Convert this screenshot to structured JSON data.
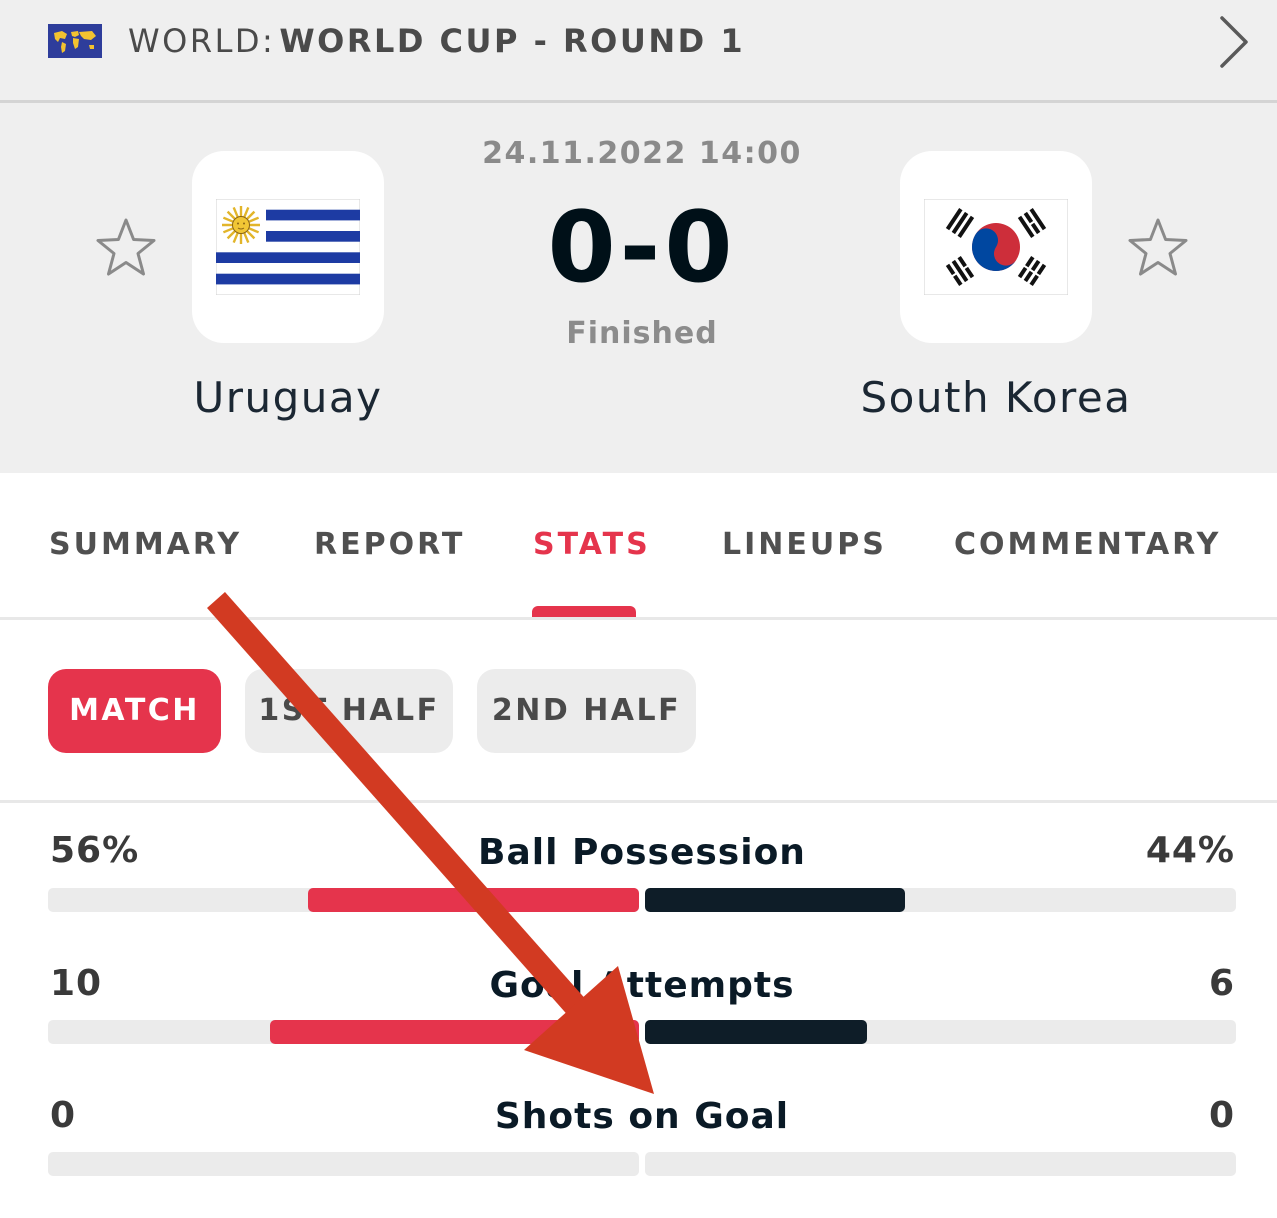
{
  "league": {
    "prefix": "WORLD:",
    "name": "WORLD CUP - ROUND 1",
    "flag_icon": "world-map-icon",
    "arrow_icon": "chevron-right-icon"
  },
  "match": {
    "datetime": "24.11.2022 14:00",
    "score": "0-0",
    "status": "Finished",
    "home": {
      "name": "Uruguay",
      "flag_icon": "uruguay-flag-icon"
    },
    "away": {
      "name": "South Korea",
      "flag_icon": "south-korea-flag-icon"
    },
    "favorite_icon": "star-outline-icon"
  },
  "tabs": [
    {
      "label": "SUMMARY",
      "active": false
    },
    {
      "label": "REPORT",
      "active": false
    },
    {
      "label": "STATS",
      "active": true
    },
    {
      "label": "LINEUPS",
      "active": false
    },
    {
      "label": "COMMENTARY",
      "active": false
    }
  ],
  "periods": [
    {
      "label": "MATCH",
      "active": true
    },
    {
      "label": "1ST HALF",
      "active": false
    },
    {
      "label": "2ND HALF",
      "active": false
    }
  ],
  "stats": [
    {
      "name": "Ball Possession",
      "home": "56%",
      "away": "44%",
      "home_share": 0.56,
      "away_share": 0.44
    },
    {
      "name": "Goal Attempts",
      "home": "10",
      "away": "6",
      "home_share": 0.625,
      "away_share": 0.375
    },
    {
      "name": "Shots on Goal",
      "home": "0",
      "away": "0",
      "home_share": 0,
      "away_share": 0
    }
  ],
  "colors": {
    "accent": "#e5344c",
    "away_bar": "#0e1d28",
    "annotation_arrow": "#d23a22"
  },
  "annotation": {
    "icon": "red-arrow-annotation"
  }
}
